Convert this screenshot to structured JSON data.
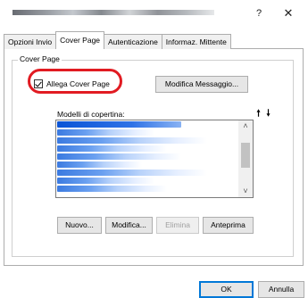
{
  "window": {
    "help_label": "?",
    "close_label": "✕"
  },
  "tabs": [
    {
      "label": "Opzioni Invio",
      "active": false
    },
    {
      "label": "Cover Page",
      "active": true
    },
    {
      "label": "Autenticazione",
      "active": false
    },
    {
      "label": "Informaz. Mittente",
      "active": false
    }
  ],
  "cover_page": {
    "group_title": "Cover Page",
    "attach_checkbox": {
      "label": "Allega Cover Page",
      "checked": true
    },
    "edit_message_button": "Modifica Messaggio...",
    "templates_label": "Modelli di copertina:",
    "move_up_icon": "arrow-up-icon",
    "move_down_icon": "arrow-down-icon",
    "buttons": {
      "new": "Nuovo...",
      "edit": "Modifica...",
      "delete": "Elimina",
      "preview": "Anteprima"
    }
  },
  "footer": {
    "ok": "OK",
    "cancel": "Annulla"
  },
  "colors": {
    "highlight_ring": "#e11b22",
    "selection": "#0a54d6"
  }
}
